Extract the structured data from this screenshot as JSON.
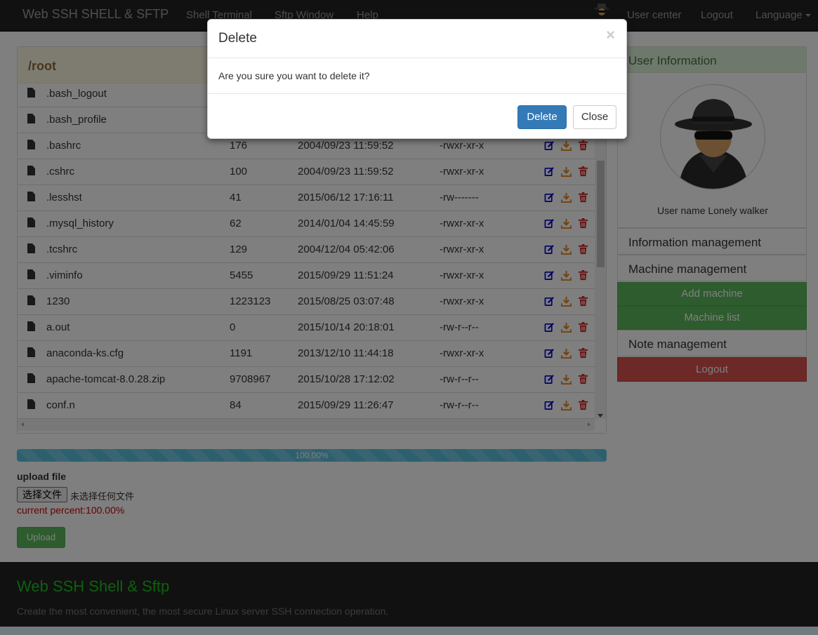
{
  "navbar": {
    "brand": "Web SSH SHELL & SFTP",
    "links": [
      "Shell Terminal",
      "Sftp Window",
      "Help"
    ],
    "user_center": "User center",
    "logout": "Logout",
    "language": "Language"
  },
  "file_panel": {
    "path": "/root",
    "files": [
      {
        "name": ".bash_logout",
        "size": "",
        "date": "",
        "perm": ""
      },
      {
        "name": ".bash_profile",
        "size": "",
        "date": "",
        "perm": ""
      },
      {
        "name": ".bashrc",
        "size": "176",
        "date": "2004/09/23 11:59:52",
        "perm": "-rwxr-xr-x"
      },
      {
        "name": ".cshrc",
        "size": "100",
        "date": "2004/09/23 11:59:52",
        "perm": "-rwxr-xr-x"
      },
      {
        "name": ".lesshst",
        "size": "41",
        "date": "2015/06/12 17:16:11",
        "perm": "-rw-------"
      },
      {
        "name": ".mysql_history",
        "size": "62",
        "date": "2014/01/04 14:45:59",
        "perm": "-rwxr-xr-x"
      },
      {
        "name": ".tcshrc",
        "size": "129",
        "date": "2004/12/04 05:42:06",
        "perm": "-rwxr-xr-x"
      },
      {
        "name": ".viminfo",
        "size": "5455",
        "date": "2015/09/29 11:51:24",
        "perm": "-rwxr-xr-x"
      },
      {
        "name": "1230",
        "size": "1223123",
        "date": "2015/08/25 03:07:48",
        "perm": "-rwxr-xr-x"
      },
      {
        "name": "a.out",
        "size": "0",
        "date": "2015/10/14 20:18:01",
        "perm": "-rw-r--r--"
      },
      {
        "name": "anaconda-ks.cfg",
        "size": "1191",
        "date": "2013/12/10 11:44:18",
        "perm": "-rwxr-xr-x"
      },
      {
        "name": "apache-tomcat-8.0.28.zip",
        "size": "9708967",
        "date": "2015/10/28 17:12:02",
        "perm": "-rw-r--r--"
      },
      {
        "name": "conf.n",
        "size": "84",
        "date": "2015/09/29 11:26:47",
        "perm": "-rw-r--r--"
      }
    ],
    "action_icons": [
      "edit-icon",
      "download-icon",
      "trash-icon"
    ],
    "colors": {
      "edit": "#0000cc",
      "download": "#e8871a",
      "trash": "#cc2222"
    }
  },
  "upload": {
    "progress_value": 1.0,
    "progress_text": "100.00%",
    "label": "upload file",
    "choose_button": "选择文件",
    "no_file_text": "未选择任何文件",
    "current_percent": "current percent:100.00%",
    "upload_button": "Upload"
  },
  "sidebar": {
    "user_info_title": "User Information",
    "user_name": "User name Lonely walker",
    "information_management": "Information management",
    "machine_management": "Machine management",
    "add_machine": "Add machine",
    "machine_list": "Machine list",
    "note_management": "Note management",
    "logout": "Logout"
  },
  "footer": {
    "title": "Web SSH Shell & Sftp",
    "subtitle": "Create the most convenient, the most secure Linux server SSH connection operation."
  },
  "modal": {
    "title": "Delete",
    "close_x": "×",
    "message": "Are you sure you want to delete it?",
    "delete_button": "Delete",
    "close_button": "Close"
  }
}
